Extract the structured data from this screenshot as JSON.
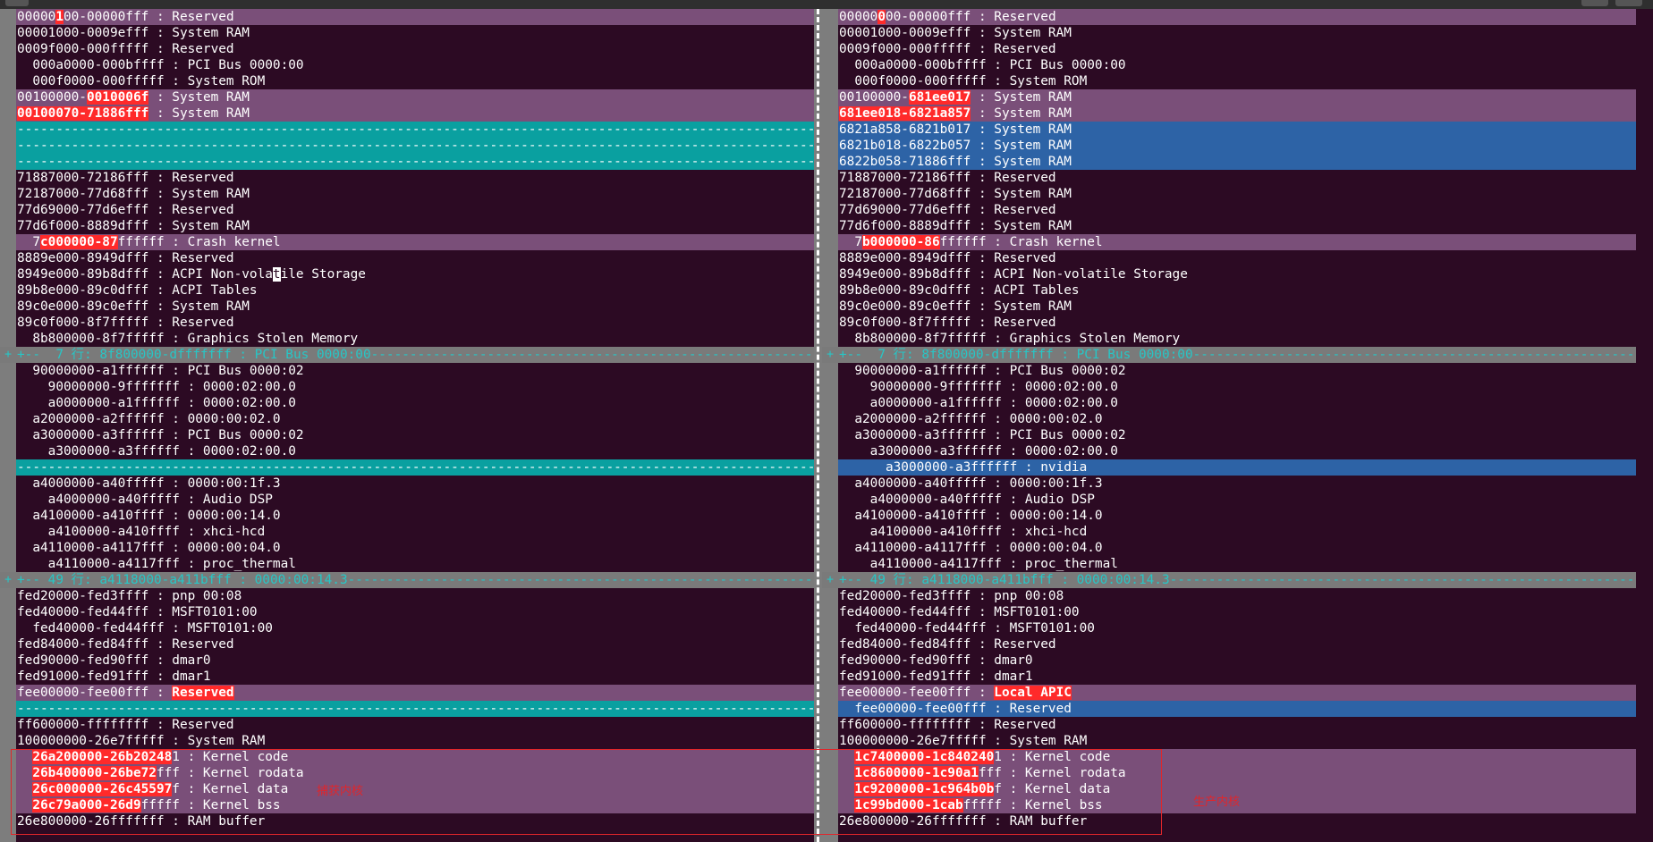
{
  "left": {
    "lines": [
      {
        "state": "chg",
        "segs": [
          {
            "t": "00000"
          },
          {
            "t": "1",
            "hl": true
          },
          {
            "t": "00-00000fff : Reserved"
          }
        ]
      },
      {
        "state": "",
        "segs": [
          {
            "t": "00001000-0009efff : System RAM"
          }
        ]
      },
      {
        "state": "",
        "segs": [
          {
            "t": "0009f000-000fffff : Reserved"
          }
        ]
      },
      {
        "state": "",
        "segs": [
          {
            "t": "  000a0000-000bffff : PCI Bus 0000:00"
          }
        ]
      },
      {
        "state": "",
        "segs": [
          {
            "t": "  000f0000-000fffff : System ROM"
          }
        ]
      },
      {
        "state": "chg",
        "segs": [
          {
            "t": "00100000-"
          },
          {
            "t": "0010006f",
            "hl": true
          },
          {
            "t": " : System RAM"
          }
        ]
      },
      {
        "state": "chg",
        "segs": [
          {
            "t": "00100070-71886fff",
            "hl": true
          },
          {
            "t": " : System RAM"
          }
        ]
      },
      {
        "state": "fill",
        "segs": [
          {
            "t": "------------------------------------------------------------------------------------------------------------------------------"
          }
        ]
      },
      {
        "state": "fill",
        "segs": [
          {
            "t": "------------------------------------------------------------------------------------------------------------------------------"
          }
        ]
      },
      {
        "state": "fill",
        "segs": [
          {
            "t": "------------------------------------------------------------------------------------------------------------------------------"
          }
        ]
      },
      {
        "state": "",
        "segs": [
          {
            "t": "71887000-72186fff : Reserved"
          }
        ]
      },
      {
        "state": "",
        "segs": [
          {
            "t": "72187000-77d68fff : System RAM"
          }
        ]
      },
      {
        "state": "",
        "segs": [
          {
            "t": "77d69000-77d6efff : Reserved"
          }
        ]
      },
      {
        "state": "",
        "segs": [
          {
            "t": "77d6f000-8889dfff : System RAM"
          }
        ]
      },
      {
        "state": "chg",
        "segs": [
          {
            "t": "  7"
          },
          {
            "t": "c000000-87",
            "hl": true
          },
          {
            "t": "ffffff : Crash kernel"
          }
        ]
      },
      {
        "state": "",
        "segs": [
          {
            "t": "8889e000-8949dfff : Reserved"
          }
        ]
      },
      {
        "state": "",
        "segs": [
          {
            "t": "8949e000-89b8dfff : ACPI Non-vola"
          },
          {
            "t": "t",
            "cur": true
          },
          {
            "t": "ile Storage"
          }
        ]
      },
      {
        "state": "",
        "segs": [
          {
            "t": "89b8e000-89c0dfff : ACPI Tables"
          }
        ]
      },
      {
        "state": "",
        "segs": [
          {
            "t": "89c0e000-89c0efff : System RAM"
          }
        ]
      },
      {
        "state": "",
        "segs": [
          {
            "t": "89c0f000-8f7fffff : Reserved"
          }
        ]
      },
      {
        "state": "",
        "segs": [
          {
            "t": "  8b800000-8f7fffff : Graphics Stolen Memory"
          }
        ]
      },
      {
        "state": "fold",
        "gutter": "+",
        "segs": [
          {
            "t": "+--  7 行: 8f800000-dfffffff : PCI Bus 0000:00------------------------------------------------------------------------------"
          }
        ]
      },
      {
        "state": "",
        "segs": [
          {
            "t": "  90000000-a1ffffff : PCI Bus 0000:02"
          }
        ]
      },
      {
        "state": "",
        "segs": [
          {
            "t": "    90000000-9fffffff : 0000:02:00.0"
          }
        ]
      },
      {
        "state": "",
        "segs": [
          {
            "t": "    a0000000-a1ffffff : 0000:02:00.0"
          }
        ]
      },
      {
        "state": "",
        "segs": [
          {
            "t": "  a2000000-a2ffffff : 0000:00:02.0"
          }
        ]
      },
      {
        "state": "",
        "segs": [
          {
            "t": "  a3000000-a3ffffff : PCI Bus 0000:02"
          }
        ]
      },
      {
        "state": "",
        "segs": [
          {
            "t": "    a3000000-a3ffffff : 0000:02:00.0"
          }
        ]
      },
      {
        "state": "fill",
        "segs": [
          {
            "t": "------------------------------------------------------------------------------------------------------------------------------"
          }
        ]
      },
      {
        "state": "",
        "segs": [
          {
            "t": "  a4000000-a40fffff : 0000:00:1f.3"
          }
        ]
      },
      {
        "state": "",
        "segs": [
          {
            "t": "    a4000000-a40fffff : Audio DSP"
          }
        ]
      },
      {
        "state": "",
        "segs": [
          {
            "t": "  a4100000-a410ffff : 0000:00:14.0"
          }
        ]
      },
      {
        "state": "",
        "segs": [
          {
            "t": "    a4100000-a410ffff : xhci-hcd"
          }
        ]
      },
      {
        "state": "",
        "segs": [
          {
            "t": "  a4110000-a4117fff : 0000:00:04.0"
          }
        ]
      },
      {
        "state": "",
        "segs": [
          {
            "t": "    a4110000-a4117fff : proc_thermal"
          }
        ]
      },
      {
        "state": "fold",
        "gutter": "+",
        "segs": [
          {
            "t": "+-- 49 行: a4118000-a411bfff : 0000:00:14.3------------------------------------------------------------------------------"
          }
        ]
      },
      {
        "state": "",
        "segs": [
          {
            "t": "fed20000-fed3ffff : pnp 00:08"
          }
        ]
      },
      {
        "state": "",
        "segs": [
          {
            "t": "fed40000-fed44fff : MSFT0101:00"
          }
        ]
      },
      {
        "state": "",
        "segs": [
          {
            "t": "  fed40000-fed44fff : MSFT0101:00"
          }
        ]
      },
      {
        "state": "",
        "segs": [
          {
            "t": "fed84000-fed84fff : Reserved"
          }
        ]
      },
      {
        "state": "",
        "segs": [
          {
            "t": "fed90000-fed90fff : dmar0"
          }
        ]
      },
      {
        "state": "",
        "segs": [
          {
            "t": "fed91000-fed91fff : dmar1"
          }
        ]
      },
      {
        "state": "chg",
        "segs": [
          {
            "t": "fee00000-fee00fff : "
          },
          {
            "t": "Reserved",
            "hl": true
          }
        ]
      },
      {
        "state": "fill",
        "segs": [
          {
            "t": "------------------------------------------------------------------------------------------------------------------------------"
          }
        ]
      },
      {
        "state": "",
        "segs": [
          {
            "t": "ff600000-ffffffff : Reserved"
          }
        ]
      },
      {
        "state": "",
        "segs": [
          {
            "t": "100000000-26e7fffff : System RAM"
          }
        ]
      },
      {
        "state": "chg",
        "segs": [
          {
            "t": "  "
          },
          {
            "t": "26a200000-26b20248",
            "hl": true
          },
          {
            "t": "1 : Kernel code"
          }
        ]
      },
      {
        "state": "chg",
        "segs": [
          {
            "t": "  "
          },
          {
            "t": "26b400000-26be72",
            "hl": true
          },
          {
            "t": "fff : Kernel rodata"
          }
        ]
      },
      {
        "state": "chg",
        "segs": [
          {
            "t": "  "
          },
          {
            "t": "26c000000-26c45597",
            "hl": true
          },
          {
            "t": "f : Kernel data"
          }
        ]
      },
      {
        "state": "chg",
        "segs": [
          {
            "t": "  "
          },
          {
            "t": "26c79a000-26d9",
            "hl": true
          },
          {
            "t": "fffff : Kernel bss"
          }
        ]
      },
      {
        "state": "",
        "segs": [
          {
            "t": "26e800000-26fffffff : RAM buffer"
          }
        ]
      }
    ]
  },
  "right": {
    "lines": [
      {
        "state": "chg",
        "segs": [
          {
            "t": "00000"
          },
          {
            "t": "0",
            "hl": true
          },
          {
            "t": "00-00000fff : Reserved"
          }
        ]
      },
      {
        "state": "",
        "segs": [
          {
            "t": "00001000-0009efff : System RAM"
          }
        ]
      },
      {
        "state": "",
        "segs": [
          {
            "t": "0009f000-000fffff : Reserved"
          }
        ]
      },
      {
        "state": "",
        "segs": [
          {
            "t": "  000a0000-000bffff : PCI Bus 0000:00"
          }
        ]
      },
      {
        "state": "",
        "segs": [
          {
            "t": "  000f0000-000fffff : System ROM"
          }
        ]
      },
      {
        "state": "chg",
        "segs": [
          {
            "t": "00100000-"
          },
          {
            "t": "681ee017",
            "hl": true
          },
          {
            "t": " : System RAM"
          }
        ]
      },
      {
        "state": "chg",
        "segs": [
          {
            "t": "681ee018-6821a857",
            "hl": true
          },
          {
            "t": " : System RAM"
          }
        ]
      },
      {
        "state": "add",
        "segs": [
          {
            "t": "6821a858-6821b017 : System RAM"
          }
        ]
      },
      {
        "state": "add",
        "segs": [
          {
            "t": "6821b018-6822b057 : System RAM"
          }
        ]
      },
      {
        "state": "add",
        "segs": [
          {
            "t": "6822b058-71886fff : System RAM"
          }
        ]
      },
      {
        "state": "",
        "segs": [
          {
            "t": "71887000-72186fff : Reserved"
          }
        ]
      },
      {
        "state": "",
        "segs": [
          {
            "t": "72187000-77d68fff : System RAM"
          }
        ]
      },
      {
        "state": "",
        "segs": [
          {
            "t": "77d69000-77d6efff : Reserved"
          }
        ]
      },
      {
        "state": "",
        "segs": [
          {
            "t": "77d6f000-8889dfff : System RAM"
          }
        ]
      },
      {
        "state": "chg",
        "segs": [
          {
            "t": "  7"
          },
          {
            "t": "b000000-86",
            "hl": true
          },
          {
            "t": "ffffff : Crash kernel"
          }
        ]
      },
      {
        "state": "",
        "segs": [
          {
            "t": "8889e000-8949dfff : Reserved"
          }
        ]
      },
      {
        "state": "",
        "segs": [
          {
            "t": "8949e000-89b8dfff : ACPI Non-volatile Storage"
          }
        ]
      },
      {
        "state": "",
        "segs": [
          {
            "t": "89b8e000-89c0dfff : ACPI Tables"
          }
        ]
      },
      {
        "state": "",
        "segs": [
          {
            "t": "89c0e000-89c0efff : System RAM"
          }
        ]
      },
      {
        "state": "",
        "segs": [
          {
            "t": "89c0f000-8f7fffff : Reserved"
          }
        ]
      },
      {
        "state": "",
        "segs": [
          {
            "t": "  8b800000-8f7fffff : Graphics Stolen Memory"
          }
        ]
      },
      {
        "state": "fold",
        "gutter": "+",
        "segs": [
          {
            "t": "+--  7 行: 8f800000-dfffffff : PCI Bus 0000:00------------------------------------------------------------------------------"
          }
        ]
      },
      {
        "state": "",
        "segs": [
          {
            "t": "  90000000-a1ffffff : PCI Bus 0000:02"
          }
        ]
      },
      {
        "state": "",
        "segs": [
          {
            "t": "    90000000-9fffffff : 0000:02:00.0"
          }
        ]
      },
      {
        "state": "",
        "segs": [
          {
            "t": "    a0000000-a1ffffff : 0000:02:00.0"
          }
        ]
      },
      {
        "state": "",
        "segs": [
          {
            "t": "  a2000000-a2ffffff : 0000:00:02.0"
          }
        ]
      },
      {
        "state": "",
        "segs": [
          {
            "t": "  a3000000-a3ffffff : PCI Bus 0000:02"
          }
        ]
      },
      {
        "state": "",
        "segs": [
          {
            "t": "    a3000000-a3ffffff : 0000:02:00.0"
          }
        ]
      },
      {
        "state": "add",
        "segs": [
          {
            "t": "      a3000000-a3ffffff : nvidia"
          }
        ]
      },
      {
        "state": "",
        "segs": [
          {
            "t": "  a4000000-a40fffff : 0000:00:1f.3"
          }
        ]
      },
      {
        "state": "",
        "segs": [
          {
            "t": "    a4000000-a40fffff : Audio DSP"
          }
        ]
      },
      {
        "state": "",
        "segs": [
          {
            "t": "  a4100000-a410ffff : 0000:00:14.0"
          }
        ]
      },
      {
        "state": "",
        "segs": [
          {
            "t": "    a4100000-a410ffff : xhci-hcd"
          }
        ]
      },
      {
        "state": "",
        "segs": [
          {
            "t": "  a4110000-a4117fff : 0000:00:04.0"
          }
        ]
      },
      {
        "state": "",
        "segs": [
          {
            "t": "    a4110000-a4117fff : proc_thermal"
          }
        ]
      },
      {
        "state": "fold",
        "gutter": "+",
        "segs": [
          {
            "t": "+-- 49 行: a4118000-a411bfff : 0000:00:14.3------------------------------------------------------------------------------"
          }
        ]
      },
      {
        "state": "",
        "segs": [
          {
            "t": "fed20000-fed3ffff : pnp 00:08"
          }
        ]
      },
      {
        "state": "",
        "segs": [
          {
            "t": "fed40000-fed44fff : MSFT0101:00"
          }
        ]
      },
      {
        "state": "",
        "segs": [
          {
            "t": "  fed40000-fed44fff : MSFT0101:00"
          }
        ]
      },
      {
        "state": "",
        "segs": [
          {
            "t": "fed84000-fed84fff : Reserved"
          }
        ]
      },
      {
        "state": "",
        "segs": [
          {
            "t": "fed90000-fed90fff : dmar0"
          }
        ]
      },
      {
        "state": "",
        "segs": [
          {
            "t": "fed91000-fed91fff : dmar1"
          }
        ]
      },
      {
        "state": "chg",
        "segs": [
          {
            "t": "fee00000-fee00fff : "
          },
          {
            "t": "Local APIC",
            "hl": true
          }
        ]
      },
      {
        "state": "add",
        "segs": [
          {
            "t": "  fee00000-fee00fff : Reserved"
          }
        ]
      },
      {
        "state": "",
        "segs": [
          {
            "t": "ff600000-ffffffff : Reserved"
          }
        ]
      },
      {
        "state": "",
        "segs": [
          {
            "t": "100000000-26e7fffff : System RAM"
          }
        ]
      },
      {
        "state": "chg",
        "segs": [
          {
            "t": "  "
          },
          {
            "t": "1c7400000-1c840240",
            "hl": true
          },
          {
            "t": "1 : Kernel code"
          }
        ]
      },
      {
        "state": "chg",
        "segs": [
          {
            "t": "  "
          },
          {
            "t": "1c8600000-1c90a1",
            "hl": true
          },
          {
            "t": "fff : Kernel rodata"
          }
        ]
      },
      {
        "state": "chg",
        "segs": [
          {
            "t": "  "
          },
          {
            "t": "1c9200000-1c964b0b",
            "hl": true
          },
          {
            "t": "f : Kernel data"
          }
        ]
      },
      {
        "state": "chg",
        "segs": [
          {
            "t": "  "
          },
          {
            "t": "1c99bd000-1cab",
            "hl": true
          },
          {
            "t": "fffff : Kernel bss"
          }
        ]
      },
      {
        "state": "",
        "segs": [
          {
            "t": "26e800000-26fffffff : RAM buffer"
          }
        ]
      }
    ]
  },
  "annotations": {
    "left_label": "捕获内核",
    "right_label": "生产内核"
  },
  "colors": {
    "background": "#2c0a23",
    "changed_line": "#7a4f79",
    "filler_line": "#0aa0a0",
    "added_line": "#2d63a6",
    "diff_text": "#ff2a2a",
    "fold_line": "#7a7a7a",
    "annotation": "#e0262b"
  }
}
